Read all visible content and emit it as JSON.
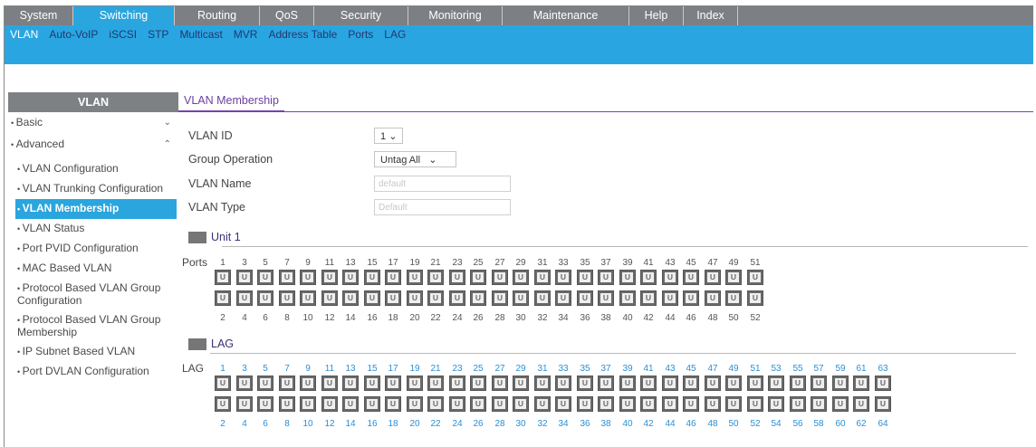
{
  "top_nav": [
    "System",
    "Switching",
    "Routing",
    "QoS",
    "Security",
    "Monitoring",
    "Maintenance",
    "Help",
    "Index"
  ],
  "top_nav_active": "Switching",
  "sub_nav": [
    "VLAN",
    "Auto-VoIP",
    "iSCSI",
    "STP",
    "Multicast",
    "MVR",
    "Address Table",
    "Ports",
    "LAG"
  ],
  "sub_nav_active": "VLAN",
  "sidebar": {
    "title": "VLAN",
    "items": [
      {
        "label": "Basic",
        "type": "top",
        "chev": "⌄"
      },
      {
        "label": "Advanced",
        "type": "top",
        "chev": "⌃"
      },
      {
        "label": "VLAN Configuration",
        "type": "sub"
      },
      {
        "label": "VLAN Trunking Configuration",
        "type": "sub"
      },
      {
        "label": "VLAN Membership",
        "type": "sub",
        "active": true
      },
      {
        "label": "VLAN Status",
        "type": "sub"
      },
      {
        "label": "Port PVID Configuration",
        "type": "sub"
      },
      {
        "label": "MAC Based VLAN",
        "type": "sub"
      },
      {
        "label": "Protocol Based VLAN Group Configuration",
        "type": "sub"
      },
      {
        "label": "Protocol Based VLAN Group Membership",
        "type": "sub"
      },
      {
        "label": "IP Subnet Based VLAN",
        "type": "sub"
      },
      {
        "label": "Port DVLAN Configuration",
        "type": "sub"
      }
    ]
  },
  "content": {
    "tab": "VLAN Membership",
    "fields": {
      "vlan_id_label": "VLAN ID",
      "vlan_id_value": "1",
      "group_op_label": "Group Operation",
      "group_op_value": "Untag All",
      "vlan_name_label": "VLAN Name",
      "vlan_name_value": "default",
      "vlan_type_label": "VLAN Type",
      "vlan_type_value": "Default"
    },
    "unit_section": "Unit 1",
    "ports_label": "Ports",
    "port_state": "U",
    "port_count": 52,
    "lag_section": "LAG",
    "lag_label": "LAG",
    "lag_count": 64
  },
  "colors": {
    "nav_gray": "#7c7f83",
    "nav_active_blue": "#2aa5de",
    "tab_purple": "#7b3fb0",
    "lag_number_blue": "#2a8fd4"
  }
}
